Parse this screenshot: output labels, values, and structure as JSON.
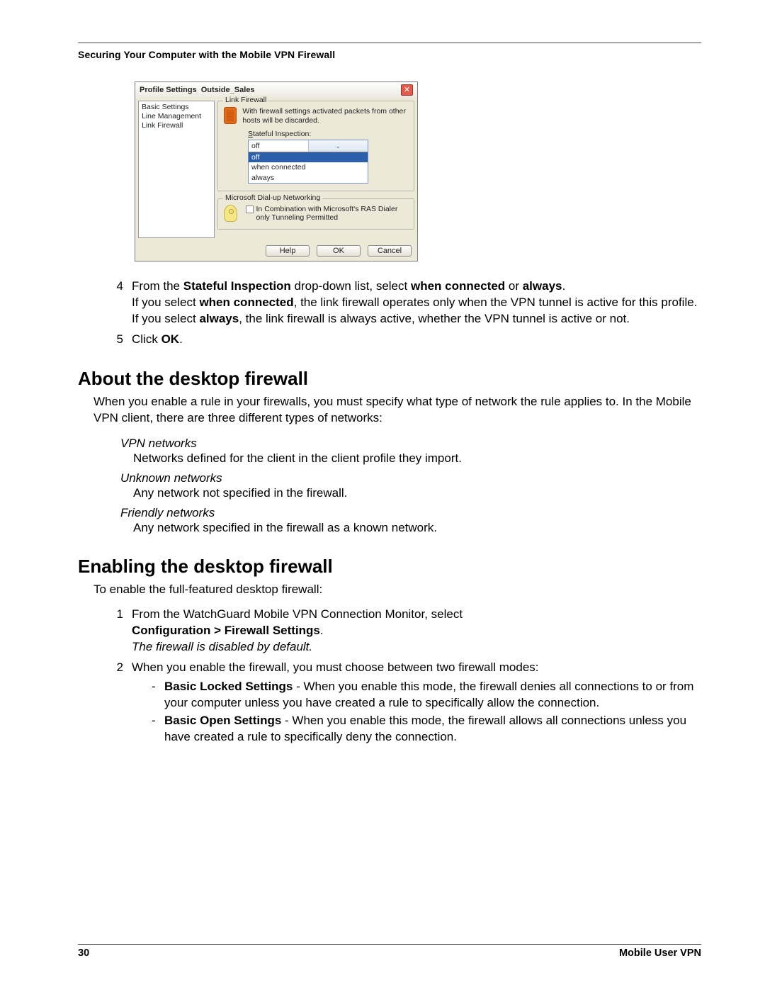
{
  "header": {
    "running_title": "Securing Your Computer with the Mobile VPN Firewall"
  },
  "dialog": {
    "title_left": "Profile Settings",
    "title_name": "Outside_Sales",
    "sidebar": [
      "Basic Settings",
      "Line Management",
      "Link Firewall"
    ],
    "group1_title": "Link Firewall",
    "desc": "With firewall settings activated packets from other hosts will be discarded.",
    "si_label_pre": "S",
    "si_label_post": "tateful Inspection:",
    "si_value": "off",
    "si_options": [
      "off",
      "when connected",
      "always"
    ],
    "group2_title": "Microsoft Dial-up Networking",
    "cb_label": "In Combination with Microsoft's RAS Dialer only Tunneling Permitted",
    "buttons": {
      "help": "Help",
      "ok": "OK",
      "cancel": "Cancel"
    }
  },
  "steps": {
    "s4": {
      "num": "4",
      "line1_a": "From the ",
      "line1_b": "Stateful Inspection",
      "line1_c": " drop-down list, select ",
      "line1_d": "when connected",
      "line1_e": " or ",
      "line1_f": "always",
      "line1_g": ".",
      "line2_a": "If you select ",
      "line2_b": "when connected",
      "line2_c": ", the link firewall operates only when the VPN tunnel is active for this profile.",
      "line3_a": "If you select ",
      "line3_b": "always",
      "line3_c": ", the link firewall is always active, whether the VPN tunnel is active or not."
    },
    "s5": {
      "num": "5",
      "a": "Click ",
      "b": "OK",
      "c": "."
    }
  },
  "about": {
    "heading": "About the desktop firewall",
    "intro": "When you enable a rule in your firewalls, you must specify what type of network the rule applies to. In the Mobile VPN client, there are three different types of networks:",
    "vpn_t": "VPN networks",
    "vpn_d": "Networks defined for the client in the client profile they import.",
    "unk_t": "Unknown networks",
    "unk_d": "Any network not specified in the firewall.",
    "fr_t": "Friendly networks",
    "fr_d": "Any network specified in the firewall as a known network."
  },
  "enable": {
    "heading": "Enabling the desktop firewall",
    "intro": "To enable the full-featured desktop firewall:",
    "s1_num": "1",
    "s1_a": "From the WatchGuard Mobile VPN Connection Monitor, select",
    "s1_b": "Configuration > Firewall Settings",
    "s1_c": ".",
    "s1_note": "The firewall is disabled by default.",
    "s2_num": "2",
    "s2_text": "When you enable the firewall, you must choose between two firewall modes:",
    "bls_t": "Basic Locked Settings",
    "bls_d": " - When you enable this mode, the firewall denies all connections to or from your computer unless you have created a rule to specifically allow the connection.",
    "bos_t": "Basic Open Settings",
    "bos_d": " - When you enable this mode, the firewall allows all connections unless you have created a rule to specifically deny the connection."
  },
  "footer": {
    "page": "30",
    "doc": "Mobile User VPN"
  }
}
